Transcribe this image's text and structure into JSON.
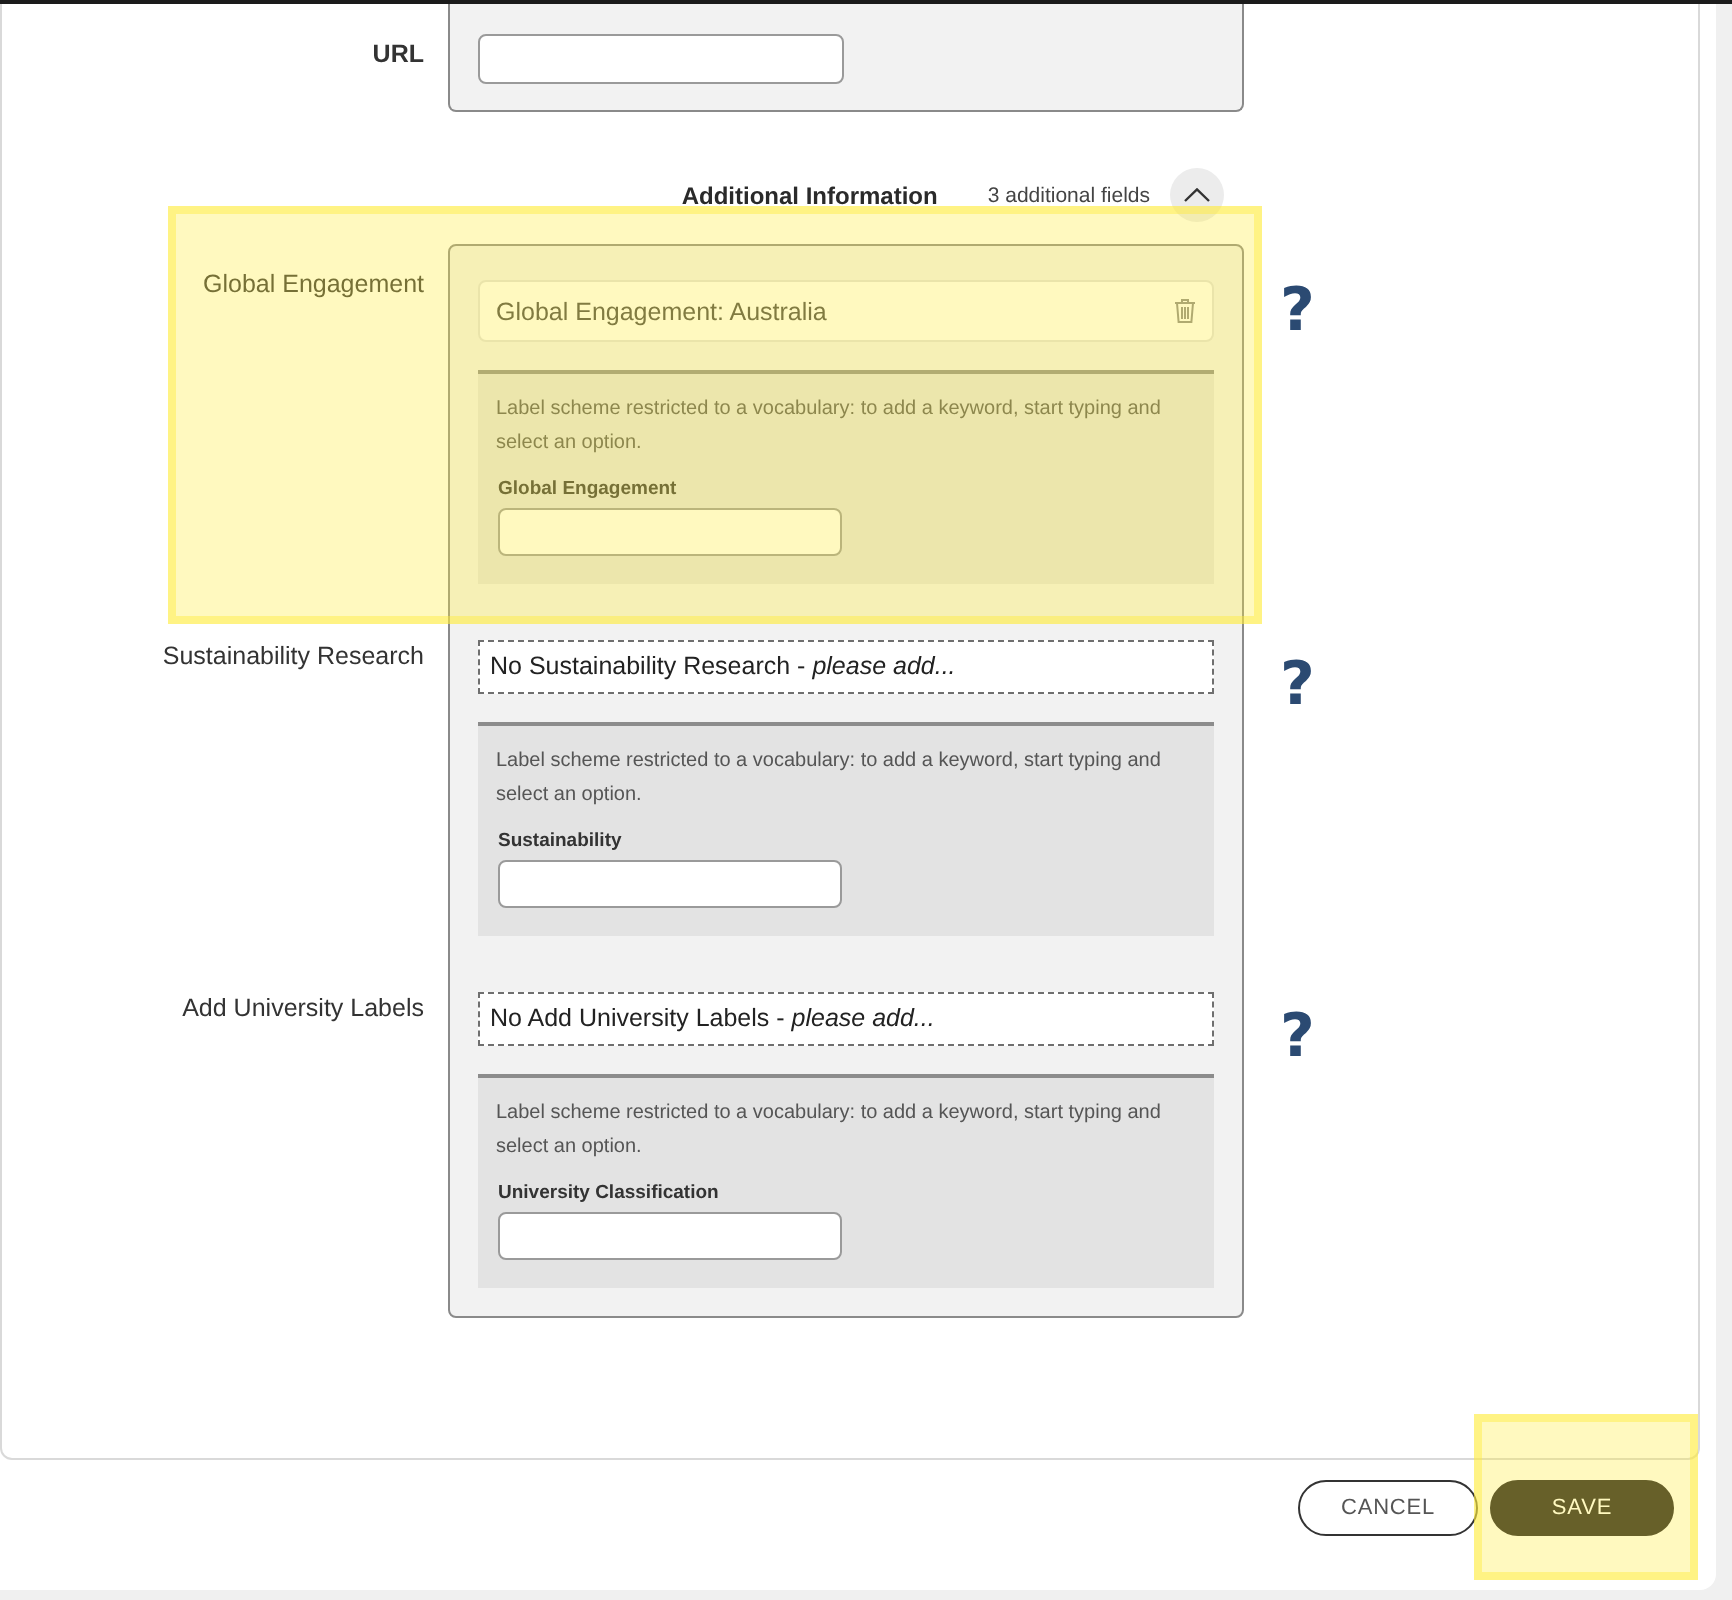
{
  "url": {
    "label": "URL"
  },
  "additional_information": {
    "title": "Additional Information",
    "count": "3 additional fields",
    "expanded": true
  },
  "fields": [
    {
      "label": "Global Engagement",
      "highlighted": true,
      "tags": [
        "Global Engagement: Australia"
      ],
      "hint": "Label scheme restricted to a vocabulary: to add a keyword, start typing and select an option.",
      "input_label": "Global Engagement",
      "help": "?"
    },
    {
      "label": "Sustainability Research",
      "highlighted": false,
      "empty_text": "No Sustainability Research - *please add...*",
      "hint": "Label scheme restricted to a vocabulary: to add a keyword, start typing and select an option.",
      "input_label": "Sustainability",
      "help": "?"
    },
    {
      "label": "Add University Labels",
      "highlighted": false,
      "empty_text": "No Add University Labels - *please add...*",
      "hint": "Label scheme restricted to a vocabulary: to add a keyword, start typing and select an option.",
      "input_label": "University Classification",
      "help": "?"
    }
  ],
  "buttons": [
    {
      "label": "CANCEL",
      "kind": "secondary",
      "highlighted": false
    },
    {
      "label": "SAVE",
      "kind": "primary",
      "highlighted": true
    }
  ]
}
